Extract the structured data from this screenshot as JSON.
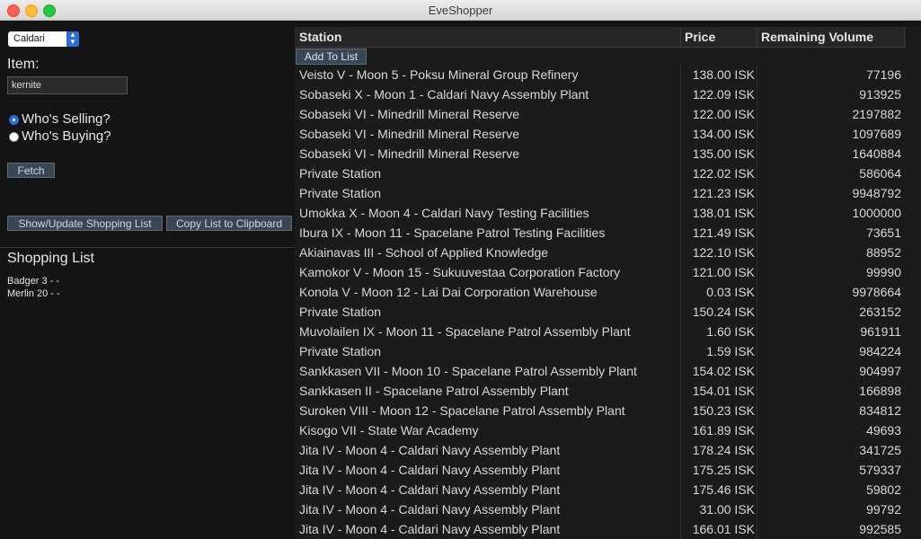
{
  "window": {
    "title": "EveShopper"
  },
  "left_panel": {
    "faction_select": "Caldari",
    "item_label": "Item:",
    "item_value": "kernite",
    "radio_selling": "Who's Selling?",
    "radio_buying": "Who's Buying?",
    "fetch_label": "Fetch",
    "show_update_label": "Show/Update Shopping List",
    "copy_label": "Copy List to Clipboard",
    "shopping_title": "Shopping List",
    "shopping_items": [
      "Badger 3 - -",
      "Merlin 20 - -"
    ]
  },
  "table": {
    "headers": {
      "station": "Station",
      "price": "Price",
      "volume": "Remaining Volume"
    },
    "add_to_list": "Add To List",
    "rows": [
      {
        "station": "Veisto V - Moon 5 - Poksu Mineral Group Refinery",
        "price": "138.00 ISK",
        "volume": "77196"
      },
      {
        "station": "Sobaseki X - Moon 1 - Caldari Navy Assembly Plant",
        "price": "122.09 ISK",
        "volume": "913925"
      },
      {
        "station": "Sobaseki VI - Minedrill Mineral Reserve",
        "price": "122.00 ISK",
        "volume": "2197882"
      },
      {
        "station": "Sobaseki VI - Minedrill Mineral Reserve",
        "price": "134.00 ISK",
        "volume": "1097689"
      },
      {
        "station": "Sobaseki VI - Minedrill Mineral Reserve",
        "price": "135.00 ISK",
        "volume": "1640884"
      },
      {
        "station": "Private Station",
        "price": "122.02 ISK",
        "volume": "586064"
      },
      {
        "station": "Private Station",
        "price": "121.23 ISK",
        "volume": "9948792"
      },
      {
        "station": "Umokka X - Moon 4 - Caldari Navy Testing Facilities",
        "price": "138.01 ISK",
        "volume": "1000000"
      },
      {
        "station": "Ibura IX - Moon 11 - Spacelane Patrol Testing Facilities",
        "price": "121.49 ISK",
        "volume": "73651"
      },
      {
        "station": "Akiainavas III - School of Applied Knowledge",
        "price": "122.10 ISK",
        "volume": "88952"
      },
      {
        "station": "Kamokor V - Moon 15 - Sukuuvestaa Corporation Factory",
        "price": "121.00 ISK",
        "volume": "99990"
      },
      {
        "station": "Konola V - Moon 12 - Lai Dai Corporation Warehouse",
        "price": "0.03 ISK",
        "volume": "9978664"
      },
      {
        "station": "Private Station",
        "price": "150.24 ISK",
        "volume": "263152"
      },
      {
        "station": "Muvolailen IX - Moon 11 - Spacelane Patrol Assembly Plant",
        "price": "1.60 ISK",
        "volume": "961911"
      },
      {
        "station": "Private Station",
        "price": "1.59 ISK",
        "volume": "984224"
      },
      {
        "station": "Sankkasen VII - Moon 10 - Spacelane Patrol Assembly Plant",
        "price": "154.02 ISK",
        "volume": "904997"
      },
      {
        "station": "Sankkasen II - Spacelane Patrol Assembly Plant",
        "price": "154.01 ISK",
        "volume": "166898"
      },
      {
        "station": "Suroken VIII - Moon 12 - Spacelane Patrol Assembly Plant",
        "price": "150.23 ISK",
        "volume": "834812"
      },
      {
        "station": "Kisogo VII - State War Academy",
        "price": "161.89 ISK",
        "volume": "49693"
      },
      {
        "station": "Jita IV - Moon 4 - Caldari Navy Assembly Plant",
        "price": "178.24 ISK",
        "volume": "341725"
      },
      {
        "station": "Jita IV - Moon 4 - Caldari Navy Assembly Plant",
        "price": "175.25 ISK",
        "volume": "579337"
      },
      {
        "station": "Jita IV - Moon 4 - Caldari Navy Assembly Plant",
        "price": "175.46 ISK",
        "volume": "59802"
      },
      {
        "station": "Jita IV - Moon 4 - Caldari Navy Assembly Plant",
        "price": "31.00 ISK",
        "volume": "99792"
      },
      {
        "station": "Jita IV - Moon 4 - Caldari Navy Assembly Plant",
        "price": "166.01 ISK",
        "volume": "992585"
      }
    ]
  }
}
